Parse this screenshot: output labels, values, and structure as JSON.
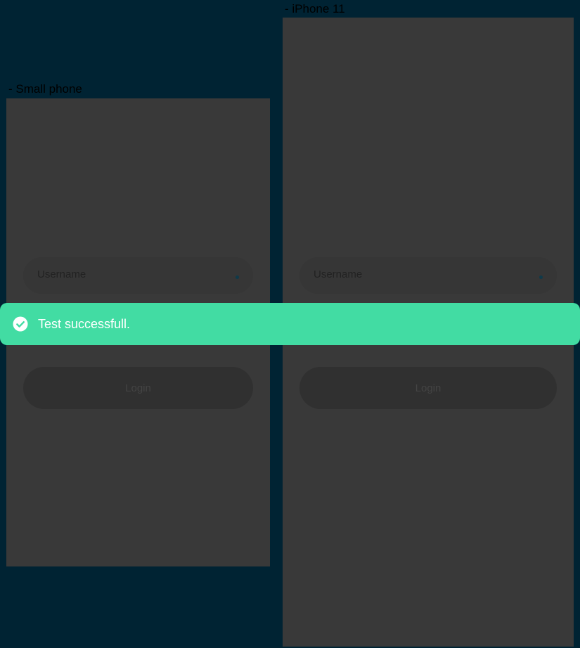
{
  "devices": [
    {
      "label": "- Small phone",
      "username_label": "Username",
      "login_label": "Login"
    },
    {
      "label": "- iPhone 11",
      "username_label": "Username",
      "login_label": "Login"
    }
  ],
  "toast": {
    "message": "Test successfull.",
    "icon": "check-circle-icon",
    "color": "#42dca3"
  },
  "colors": {
    "canvas_background": "#002333",
    "frame_background": "#393939"
  }
}
